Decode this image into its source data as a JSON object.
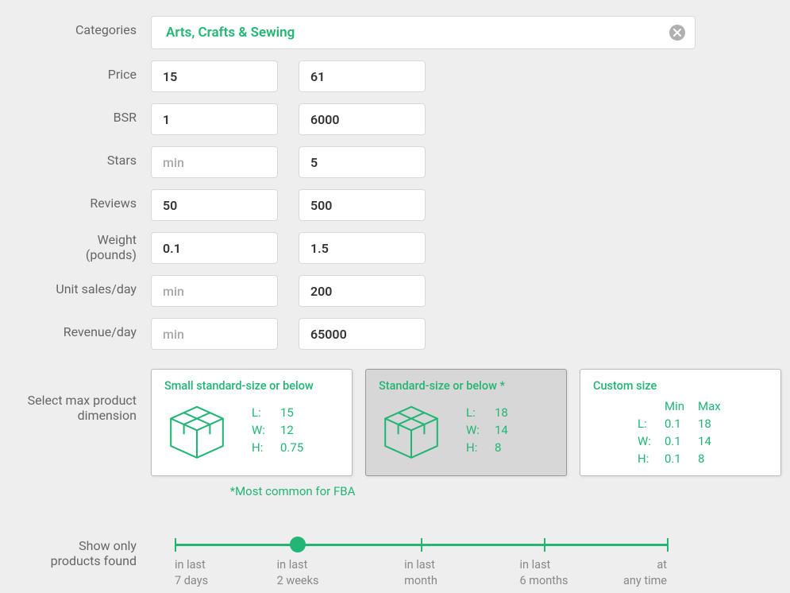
{
  "categories": {
    "label": "Categories",
    "value": "Arts, Crafts & Sewing"
  },
  "filters": {
    "price": {
      "label": "Price",
      "min": "15",
      "max": "61"
    },
    "bsr": {
      "label": "BSR",
      "min": "1",
      "max": "6000"
    },
    "stars": {
      "label": "Stars",
      "min": "",
      "max": "5",
      "min_placeholder": "min"
    },
    "reviews": {
      "label": "Reviews",
      "min": "50",
      "max": "500"
    },
    "weight": {
      "label_l1": "Weight",
      "label_l2": "(pounds)",
      "min": "0.1",
      "max": "1.5"
    },
    "units": {
      "label": "Unit sales/day",
      "min": "",
      "max": "200",
      "min_placeholder": "min"
    },
    "revenue": {
      "label": "Revenue/day",
      "min": "",
      "max": "65000",
      "min_placeholder": "min"
    }
  },
  "dimension": {
    "label_l1": "Select max product",
    "label_l2": "dimension",
    "cards": {
      "small": {
        "title": "Small standard-size or below",
        "L": "15",
        "W": "12",
        "H": "0.75"
      },
      "standard": {
        "title": "Standard-size or below *",
        "L": "18",
        "W": "14",
        "H": "8",
        "selected": true
      },
      "custom": {
        "title": "Custom size",
        "header_min": "Min",
        "header_max": "Max",
        "L_min": "0.1",
        "L_max": "18",
        "W_min": "0.1",
        "W_max": "14",
        "H_min": "0.1",
        "H_max": "8"
      }
    },
    "key_L": "L:",
    "key_W": "W:",
    "key_H": "H:",
    "fba_note": "*Most common for FBA"
  },
  "timeline": {
    "label_l1": "Show only",
    "label_l2": "products found",
    "options": [
      {
        "l1": "in last",
        "l2": "7 days"
      },
      {
        "l1": "in last",
        "l2": "2 weeks"
      },
      {
        "l1": "in last",
        "l2": "month"
      },
      {
        "l1": "in last",
        "l2": "6 months"
      },
      {
        "l1": "at",
        "l2": "any time"
      }
    ],
    "selected_index": 1
  }
}
